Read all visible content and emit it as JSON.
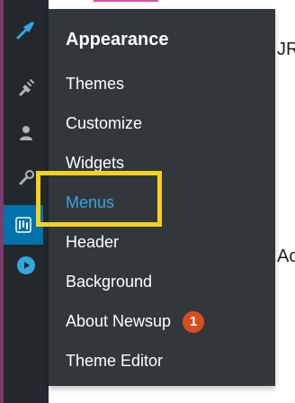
{
  "sidebar": {
    "icons": [
      {
        "name": "pin-icon"
      },
      {
        "name": "plugins-icon"
      },
      {
        "name": "users-icon"
      },
      {
        "name": "tools-icon"
      },
      {
        "name": "settings-icon"
      },
      {
        "name": "play-icon"
      }
    ]
  },
  "flyout": {
    "title": "Appearance",
    "items": [
      {
        "label": "Themes"
      },
      {
        "label": "Customize"
      },
      {
        "label": "Widgets"
      },
      {
        "label": "Menus"
      },
      {
        "label": "Header"
      },
      {
        "label": "Background"
      },
      {
        "label": "About Newsup",
        "badge": "1"
      },
      {
        "label": "Theme Editor"
      }
    ]
  },
  "background": {
    "text_top_right": "JR",
    "text_mid_right": "Ac"
  },
  "colors": {
    "sidebar": "#23282d",
    "flyout": "#32373c",
    "active_item": "#34a7e0",
    "badge": "#d54e21",
    "highlight_box": "#f4d21b"
  }
}
